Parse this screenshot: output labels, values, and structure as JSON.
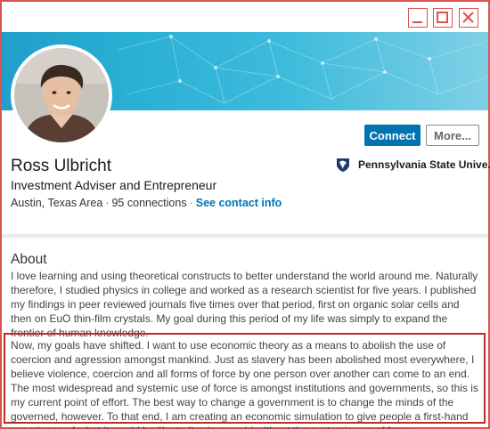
{
  "window": {
    "controls": {
      "minimize": "minimize",
      "maximize": "maximize",
      "close": "close"
    },
    "border_color": "#d9534f"
  },
  "profile": {
    "name": "Ross Ulbricht",
    "headline": "Investment Adviser and Entrepreneur",
    "location": "Austin, Texas Area",
    "connections": "95 connections",
    "contact_link": "See contact info",
    "school": "Pennsylvania State Unive...",
    "accent_color": "#0073b1"
  },
  "actions": {
    "connect_label": "Connect",
    "more_label": "More..."
  },
  "about": {
    "title": "About",
    "paragraph1": "I love learning and using theoretical constructs to better understand the world around me. Naturally therefore, I studied physics in college and worked as a research scientist for five years. I published my findings in peer reviewed journals five times over that period, first on organic solar cells and then on EuO thin-film crystals. My goal during this period of my life was simply to expand the frontier of human knowledge.",
    "paragraph2": "Now, my goals have shifted. I want to use economic theory as a means to abolish the use of coercion and agression amongst mankind. Just as slavery has been abolished most everywhere, I believe violence, coercion and all forms of force by one person over another can come to an end. The most widespread and systemic use of force is amongst institutions and governments, so this is my current point of effort. The best way to change a government is to change the minds of the governed, however. To that end, I am creating an economic simulation to give people a first-hand experience of what it would be like to live in a world without the systemic use of force.",
    "highlight_color": "#c62828"
  }
}
